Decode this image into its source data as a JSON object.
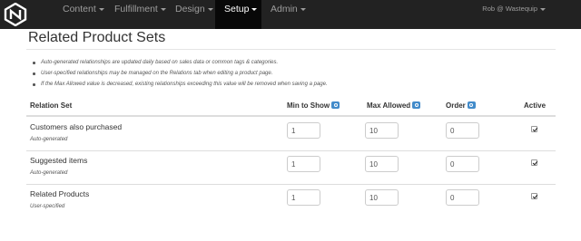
{
  "navbar": {
    "items": [
      {
        "label": "Content"
      },
      {
        "label": "Fulfillment"
      },
      {
        "label": "Design"
      },
      {
        "label": "Setup",
        "active": true
      },
      {
        "label": "Admin"
      }
    ],
    "user": "Rob @ Wastequip"
  },
  "page": {
    "title": "Related Product Sets",
    "notes": [
      "Auto-generated relationships are updated daily based on sales data or common tags & categories.",
      "User-specified relationships may be managed on the Relations tab when editing a product page.",
      "If the Max Allowed value is decreased, existing relationships exceeding this value will be removed when saving a page."
    ]
  },
  "table": {
    "headers": {
      "relation_set": "Relation Set",
      "min_to_show": "Min to Show",
      "max_allowed": "Max Allowed",
      "order": "Order",
      "active": "Active"
    },
    "rows": [
      {
        "name": "Customers also purchased",
        "type": "Auto-generated",
        "min": "1",
        "max": "10",
        "order": "0",
        "active": true
      },
      {
        "name": "Suggested items",
        "type": "Auto-generated",
        "min": "1",
        "max": "10",
        "order": "0",
        "active": true
      },
      {
        "name": "Related Products",
        "type": "User-specified",
        "min": "1",
        "max": "10",
        "order": "0",
        "active": true
      }
    ]
  },
  "colors": {
    "navbar_bg": "#222222",
    "navbar_active_bg": "#080808",
    "help_icon": "#428bca"
  }
}
